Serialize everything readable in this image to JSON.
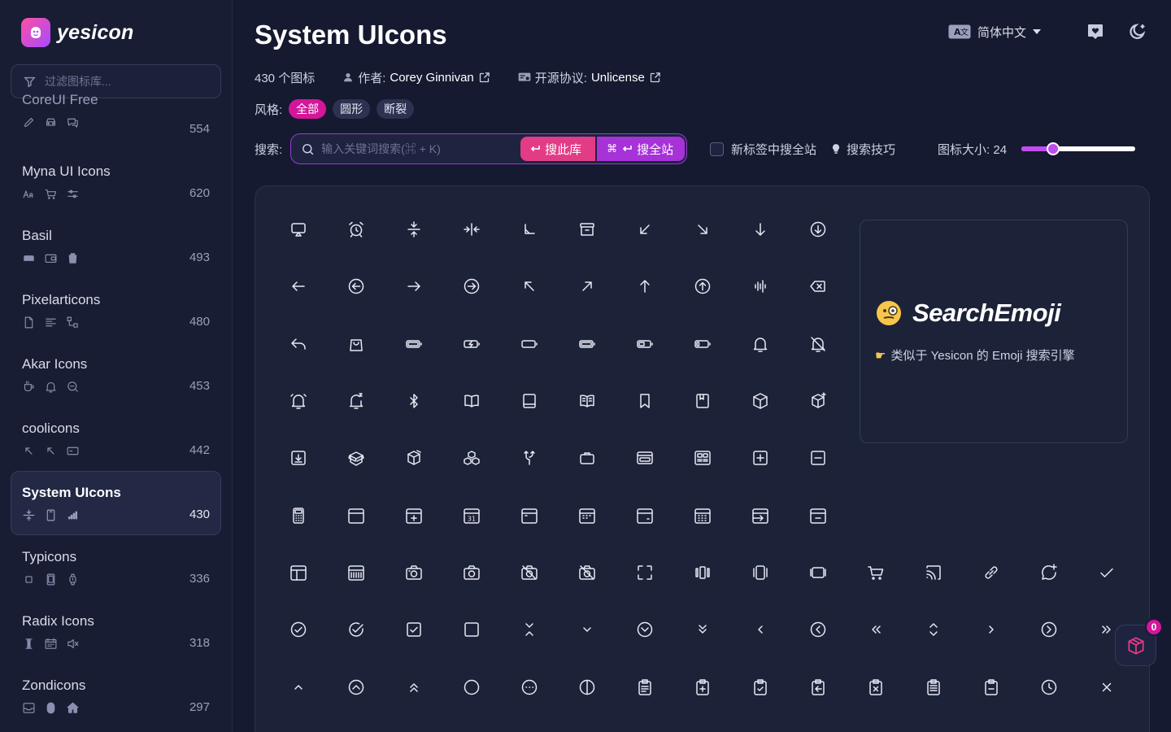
{
  "brand": {
    "name": "yesicon"
  },
  "sidebar": {
    "filter_placeholder": "过滤图标库...",
    "collections": [
      {
        "name": "CoreUI Free",
        "count": "554",
        "icons": [
          "pen-icon",
          "car-icon",
          "chat-icon"
        ],
        "partial": true
      },
      {
        "name": "Myna UI Icons",
        "count": "620",
        "icons": [
          "font-size-icon",
          "cart-icon",
          "sliders-icon"
        ]
      },
      {
        "name": "Basil",
        "count": "493",
        "icons": [
          "sofa-icon",
          "wallet-icon",
          "trash-icon"
        ]
      },
      {
        "name": "Pixelarticons",
        "count": "480",
        "icons": [
          "file-icon",
          "align-left-icon",
          "flow-icon"
        ]
      },
      {
        "name": "Akar Icons",
        "count": "453",
        "icons": [
          "cup-icon",
          "bell-icon",
          "zoom-out-icon"
        ]
      },
      {
        "name": "coolicons",
        "count": "442",
        "icons": [
          "arrow-up-left-icon",
          "arrow-up-left-icon",
          "card-icon"
        ]
      },
      {
        "name": "System UIcons",
        "count": "430",
        "icons": [
          "compress-icon",
          "phone-icon",
          "signal-icon"
        ],
        "active": true
      },
      {
        "name": "Typicons",
        "count": "336",
        "icons": [
          "square-icon",
          "tablet-icon",
          "watch-icon"
        ]
      },
      {
        "name": "Radix Icons",
        "count": "318",
        "icons": [
          "height-icon",
          "calendar-icon",
          "mute-icon"
        ]
      },
      {
        "name": "Zondicons",
        "count": "297",
        "icons": [
          "inbox-icon",
          "mouse-icon",
          "home-icon"
        ]
      }
    ]
  },
  "header": {
    "title": "System UIcons",
    "language": "简体中文",
    "icon_count": "430 个图标",
    "author_label": "作者:",
    "author": "Corey Ginnivan",
    "license_label": "开源协议:",
    "license": "Unlicense",
    "style_label": "风格:",
    "styles": [
      "全部",
      "圆形",
      "断裂"
    ]
  },
  "search": {
    "label": "搜索:",
    "placeholder": "输入关键词搜索(⌘ + K)",
    "this_lib": "搜此库",
    "all_sites": "搜全站",
    "new_tab": "新标签中搜全站",
    "tips": "搜索技巧",
    "size_label": "图标大小:",
    "size_value": "24",
    "size_fraction": 0.28
  },
  "ad": {
    "title": "SearchEmoji",
    "subtitle": "类似于 Yesicon 的 Emoji 搜索引擎"
  },
  "icons": [
    "airplay",
    "alarm-clock",
    "arrow-inside-vertical",
    "arrow-inside-horizontal",
    "arrow-bottom-left-corner",
    "archive",
    "arrow-down-left",
    "arrow-down-right",
    "arrow-down",
    "arrow-down-circle",
    "",
    "",
    "",
    "",
    "",
    "arrow-left",
    "arrow-left-circle",
    "arrow-right",
    "arrow-right-circle",
    "arrow-up-left",
    "arrow-up-right",
    "arrow-up",
    "arrow-up-circle",
    "audio-wave",
    "backspace",
    "",
    "",
    "",
    "",
    "",
    "reply",
    "bag",
    "battery-full",
    "battery-charging",
    "battery-empty",
    "battery-full-alt",
    "battery-half",
    "battery-low",
    "bell",
    "bell-off",
    "",
    "",
    "",
    "",
    "",
    "bell-ringing",
    "bell-snooze",
    "bluetooth",
    "book",
    "book-closed",
    "book-text",
    "bookmark",
    "bookmark-book",
    "box",
    "box-add",
    "",
    "",
    "",
    "",
    "",
    "box-download",
    "box-open",
    "box-edit",
    "boxes",
    "branch",
    "briefcase",
    "browser",
    "browser-alt",
    "button-add",
    "button-minus",
    "",
    "",
    "",
    "",
    "",
    "calculator",
    "calendar",
    "calendar-add",
    "calendar-date",
    "calendar-day",
    "calendar-days",
    "calendar-month",
    "calendar-grid",
    "calendar-move",
    "calendar-remove",
    "",
    "",
    "",
    "",
    "",
    "calendar-split",
    "calendar-week",
    "camera",
    "camera-alt",
    "camera-off",
    "camera-off-alt",
    "capture",
    "carousel",
    "carousel-alt",
    "carousel-simple",
    "cart",
    "cast",
    "chain",
    "chat-add",
    "check",
    "check-circle",
    "check-circle-alt",
    "checkbox",
    "checkbox-empty",
    "chevron-close",
    "chevron-down",
    "chevron-down-circle",
    "chevron-down-double",
    "chevron-left",
    "chevron-left-circle",
    "chevron-left-double",
    "chevron-open",
    "chevron-right",
    "chevron-right-circle",
    "chevron-right-double",
    "chevron-up",
    "chevron-up-circle",
    "chevron-up-double",
    "circle",
    "circle-menu",
    "circle-split",
    "clipboard-notes",
    "clipboard-add",
    "clipboard-check",
    "clipboard-copy",
    "clipboard-cross",
    "clipboard-list",
    "clipboard-remove",
    "clock",
    "close"
  ],
  "cart_badge": "0"
}
